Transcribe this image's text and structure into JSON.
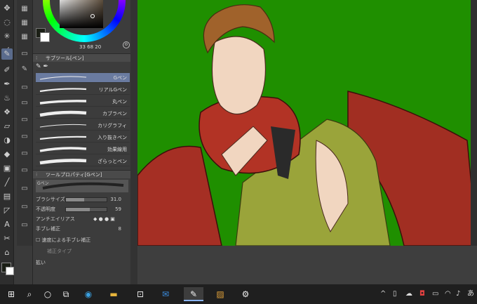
{
  "color_panel": {
    "values": "33  68  20",
    "main_color": "#1b1f16",
    "sub_color": "#ffffff"
  },
  "subtool_panel": {
    "title": "サブツール[ペン]",
    "brushes": [
      {
        "label": "Gペン",
        "selected": true
      },
      {
        "label": "リアルGペン",
        "selected": false
      },
      {
        "label": "丸ペン",
        "selected": false
      },
      {
        "label": "カブラペン",
        "selected": false
      },
      {
        "label": "カリグラフィ",
        "selected": false
      },
      {
        "label": "入り抜きペン",
        "selected": false
      },
      {
        "label": "効果線用",
        "selected": false
      },
      {
        "label": "ざらっとペン",
        "selected": false
      }
    ]
  },
  "tool_property": {
    "title": "ツールプロパティ[Gペン]",
    "preview_label": "Gペン",
    "brush_size_label": "ブラシサイズ",
    "brush_size_value": "31.0",
    "brush_size_fraction": 0.45,
    "opacity_label": "不透明度",
    "opacity_value": "59",
    "opacity_fraction": 0.59,
    "antialias_label": "アンチエイリアス",
    "stabilization_label": "手ブレ補正",
    "stabilization_value": "8",
    "speed_stabilization_label": "速度による手ブレ補正",
    "correction_type_label": "補正タイプ",
    "bottom_label": "拡い"
  },
  "taskbar": {
    "search_icon": "search-icon",
    "apps": [
      "task-view",
      "edge",
      "file-explorer",
      "store",
      "mail",
      "clip-studio",
      "paint-app",
      "settings"
    ]
  }
}
